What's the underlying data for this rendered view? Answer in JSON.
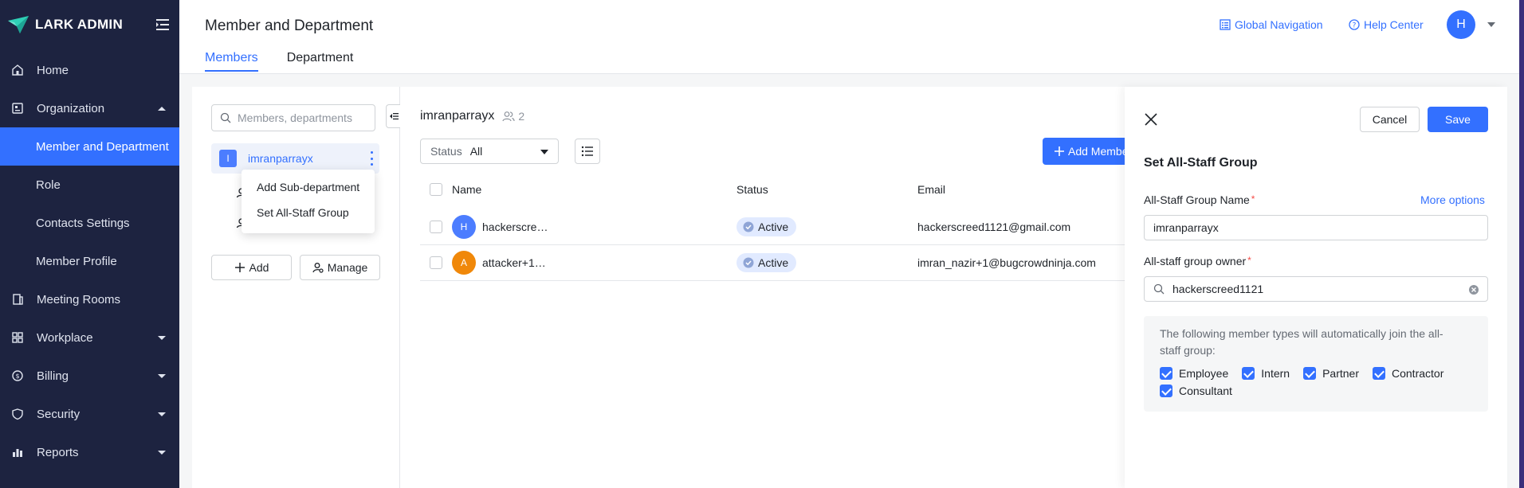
{
  "app": {
    "brand": "LARK ADMIN"
  },
  "colors": {
    "sidebar_bg": "#1d2340",
    "accent": "#3370ff",
    "active_badge_bg": "#e1eaff"
  },
  "sidebar": {
    "items": [
      {
        "label": "Home",
        "icon": "home-icon"
      },
      {
        "label": "Organization",
        "icon": "organization-icon"
      },
      {
        "label": "Member and Department"
      },
      {
        "label": "Role"
      },
      {
        "label": "Contacts Settings"
      },
      {
        "label": "Member Profile"
      },
      {
        "label": "Meeting Rooms",
        "icon": "meeting-rooms-icon"
      },
      {
        "label": "Workplace",
        "icon": "workplace-icon"
      },
      {
        "label": "Billing",
        "icon": "billing-icon"
      },
      {
        "label": "Security",
        "icon": "security-icon"
      },
      {
        "label": "Reports",
        "icon": "reports-icon"
      }
    ]
  },
  "header": {
    "title": "Member and Department",
    "global_nav": "Global Navigation",
    "help_center": "Help Center",
    "avatar_letter": "H",
    "tabs": [
      {
        "label": "Members"
      },
      {
        "label": "Department"
      }
    ]
  },
  "dept_panel": {
    "search_placeholder": "Members, departments",
    "department": {
      "badge": "I",
      "name": "imranparrayx"
    },
    "context_menu": [
      "Add Sub-department",
      "Set All-Staff Group"
    ],
    "add_label": "Add",
    "manage_label": "Manage"
  },
  "members": {
    "dept_title": "imranparrayx",
    "member_count": "2",
    "status_filter": {
      "label": "Status",
      "value": "All"
    },
    "add_member_label": "Add Member",
    "columns": {
      "name": "Name",
      "status": "Status",
      "email": "Email"
    },
    "rows": [
      {
        "avatar": "H",
        "avatar_color": "#4c7dff",
        "name": "hackerscre…",
        "status": "Active",
        "email": "hackerscreed1121@gmail.com"
      },
      {
        "avatar": "A",
        "avatar_color": "#f0880a",
        "name": "attacker+1…",
        "status": "Active",
        "email": "imran_nazir+1@bugcrowdninja.com"
      }
    ]
  },
  "drawer": {
    "cancel": "Cancel",
    "save": "Save",
    "title": "Set All-Staff Group",
    "group_name_label": "All-Staff Group Name",
    "required_mark": "*",
    "more_options": "More options",
    "group_name_value": "imranparrayx",
    "owner_label": "All-staff group owner",
    "owner_value": "hackerscreed1121",
    "info_text": "The following member types will automatically join the all-staff group:",
    "member_types": [
      "Employee",
      "Intern",
      "Partner",
      "Contractor",
      "Consultant"
    ]
  }
}
